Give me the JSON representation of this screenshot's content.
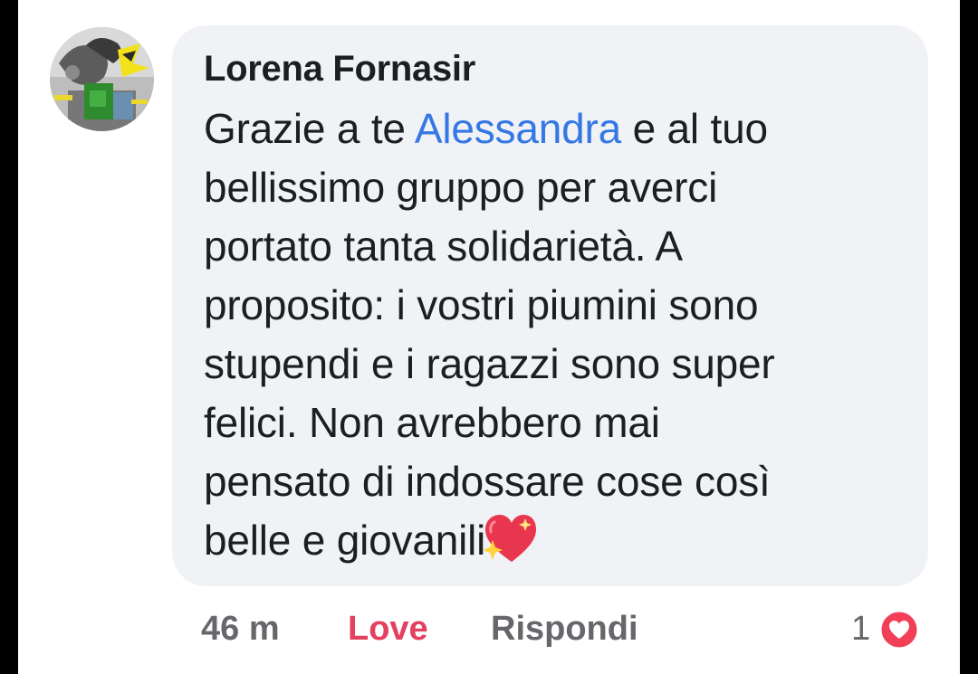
{
  "comment": {
    "author": "Lorena Fornasir",
    "lines": [
      {
        "before": "Grazie a te ",
        "mention": "Alessandra",
        "after": " e al tuo"
      },
      {
        "text": "bellissimo gruppo per averci"
      },
      {
        "text": "portato tanta solidarietà. A"
      },
      {
        "text": "proposito: i vostri piumini sono"
      },
      {
        "text": "stupendi e i ragazzi sono super"
      },
      {
        "text": "felici. Non avrebbero mai"
      },
      {
        "text": "pensato di indossare cose così"
      },
      {
        "text": "belle e giovanili"
      }
    ],
    "emoji": "sparkling-heart-emoji"
  },
  "actions": {
    "time": "46 m",
    "love": "Love",
    "reply": "Rispondi"
  },
  "reactions": {
    "count": "1",
    "icon": "love-reaction-icon"
  },
  "colors": {
    "bubble": "#f0f2f5",
    "mention": "#3578e5",
    "love": "#e4405f",
    "muted": "#65676b"
  }
}
